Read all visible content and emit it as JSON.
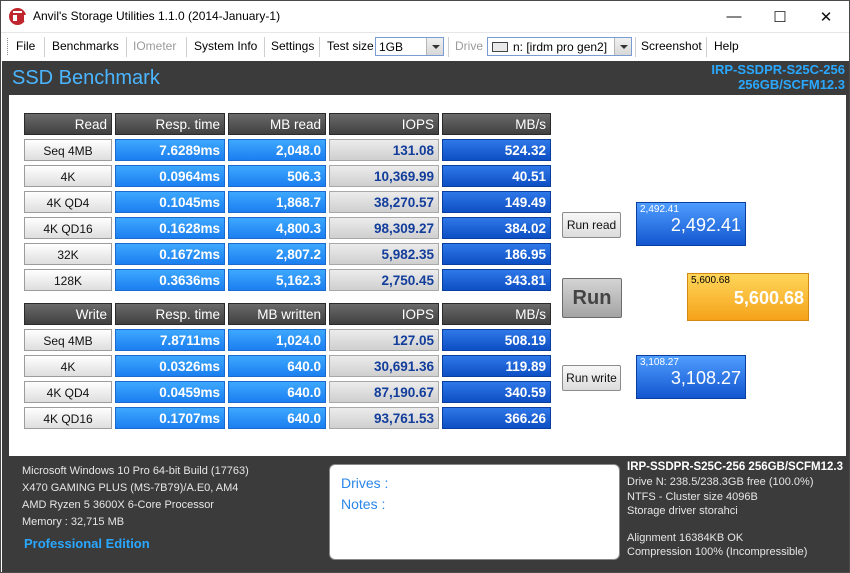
{
  "window": {
    "title": "Anvil's Storage Utilities 1.1.0 (2014-January-1)",
    "min": "—",
    "max": "☐",
    "close": "✕"
  },
  "menu": {
    "file": "File",
    "benchmarks": "Benchmarks",
    "iometer": "IOmeter",
    "sysinfo": "System Info",
    "settings": "Settings",
    "testsize_label": "Test size",
    "testsize_value": "1GB",
    "drive_label": "Drive",
    "drive_value": "n: [irdm pro gen2]",
    "screenshot": "Screenshot",
    "help": "Help"
  },
  "header": {
    "title": "SSD Benchmark",
    "drive_line1": "IRP-SSDPR-S25C-256",
    "drive_line2": "256GB/SCFM12.3"
  },
  "read": {
    "headers": [
      "Read",
      "Resp. time",
      "MB read",
      "IOPS",
      "MB/s"
    ],
    "rows": [
      [
        "Seq 4MB",
        "7.6289ms",
        "2,048.0",
        "131.08",
        "524.32"
      ],
      [
        "4K",
        "0.0964ms",
        "506.3",
        "10,369.99",
        "40.51"
      ],
      [
        "4K QD4",
        "0.1045ms",
        "1,868.7",
        "38,270.57",
        "149.49"
      ],
      [
        "4K QD16",
        "0.1628ms",
        "4,800.3",
        "98,309.27",
        "384.02"
      ],
      [
        "32K",
        "0.1672ms",
        "2,807.2",
        "5,982.35",
        "186.95"
      ],
      [
        "128K",
        "0.3636ms",
        "5,162.3",
        "2,750.45",
        "343.81"
      ]
    ]
  },
  "write": {
    "headers": [
      "Write",
      "Resp. time",
      "MB written",
      "IOPS",
      "MB/s"
    ],
    "rows": [
      [
        "Seq 4MB",
        "7.8711ms",
        "1,024.0",
        "127.05",
        "508.19"
      ],
      [
        "4K",
        "0.0326ms",
        "640.0",
        "30,691.36",
        "119.89"
      ],
      [
        "4K QD4",
        "0.0459ms",
        "640.0",
        "87,190.67",
        "340.59"
      ],
      [
        "4K QD16",
        "0.1707ms",
        "640.0",
        "93,761.53",
        "366.26"
      ]
    ]
  },
  "buttons": {
    "run_read": "Run read",
    "run": "Run",
    "run_write": "Run write"
  },
  "scores": {
    "read_small": "2,492.41",
    "read_big": "2,492.41",
    "total_small": "5,600.68",
    "total_big": "5,600.68",
    "write_small": "3,108.27",
    "write_big": "3,108.27"
  },
  "system": {
    "os": "Microsoft Windows 10 Pro 64-bit Build (17763)",
    "board": "X470 GAMING PLUS (MS-7B79)/A.E0, AM4",
    "cpu": "AMD Ryzen 5 3600X 6-Core Processor",
    "memory": "Memory : 32,715 MB",
    "edition": "Professional Edition"
  },
  "notes": {
    "drives": "Drives :",
    "notes": "Notes :"
  },
  "driveinfo": {
    "name": "IRP-SSDPR-S25C-256 256GB/SCFM12.3",
    "size": "Drive N: 238.5/238.3GB free (100.0%)",
    "fs": "NTFS - Cluster size 4096B",
    "driver": "Storage driver  storahci",
    "alignment": "Alignment 16384KB OK",
    "compression": "Compression 100% (Incompressible)"
  }
}
